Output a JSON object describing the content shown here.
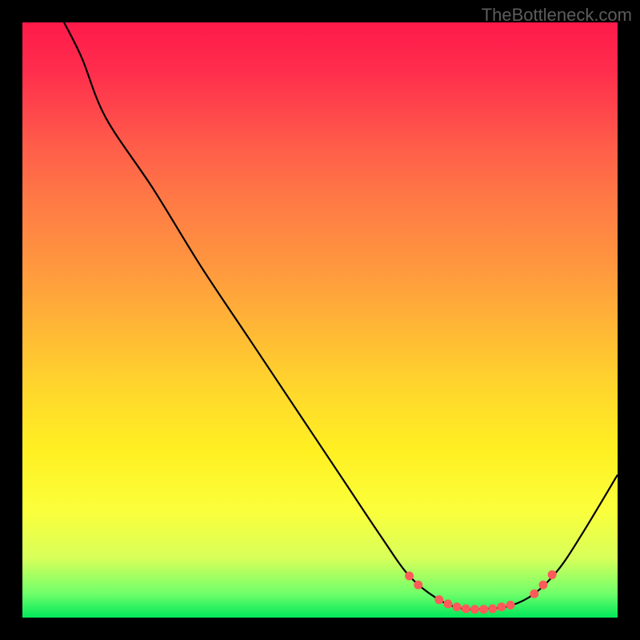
{
  "watermark": "TheBottleneck.com",
  "chart_data": {
    "type": "line",
    "title": "",
    "xlabel": "",
    "ylabel": "",
    "xlim": [
      0,
      100
    ],
    "ylim": [
      0,
      100
    ],
    "curve": [
      {
        "x": 7,
        "y": 100
      },
      {
        "x": 10,
        "y": 94
      },
      {
        "x": 14,
        "y": 84
      },
      {
        "x": 22,
        "y": 72
      },
      {
        "x": 30,
        "y": 59
      },
      {
        "x": 38,
        "y": 47
      },
      {
        "x": 46,
        "y": 35
      },
      {
        "x": 54,
        "y": 23
      },
      {
        "x": 60,
        "y": 14
      },
      {
        "x": 65,
        "y": 7
      },
      {
        "x": 70,
        "y": 3
      },
      {
        "x": 74,
        "y": 1.5
      },
      {
        "x": 78,
        "y": 1.5
      },
      {
        "x": 82,
        "y": 2
      },
      {
        "x": 86,
        "y": 4
      },
      {
        "x": 90,
        "y": 8
      },
      {
        "x": 94,
        "y": 14
      },
      {
        "x": 100,
        "y": 24
      }
    ],
    "highlight_points": [
      {
        "x": 65,
        "y": 7
      },
      {
        "x": 66.5,
        "y": 5.5
      },
      {
        "x": 70,
        "y": 3
      },
      {
        "x": 71.5,
        "y": 2.3
      },
      {
        "x": 73,
        "y": 1.8
      },
      {
        "x": 74.5,
        "y": 1.5
      },
      {
        "x": 76,
        "y": 1.4
      },
      {
        "x": 77.5,
        "y": 1.4
      },
      {
        "x": 79,
        "y": 1.5
      },
      {
        "x": 80.5,
        "y": 1.8
      },
      {
        "x": 82,
        "y": 2.1
      },
      {
        "x": 86,
        "y": 4
      },
      {
        "x": 87.5,
        "y": 5.5
      },
      {
        "x": 89,
        "y": 7.2
      }
    ],
    "highlight_color": "#ff5a5a"
  }
}
